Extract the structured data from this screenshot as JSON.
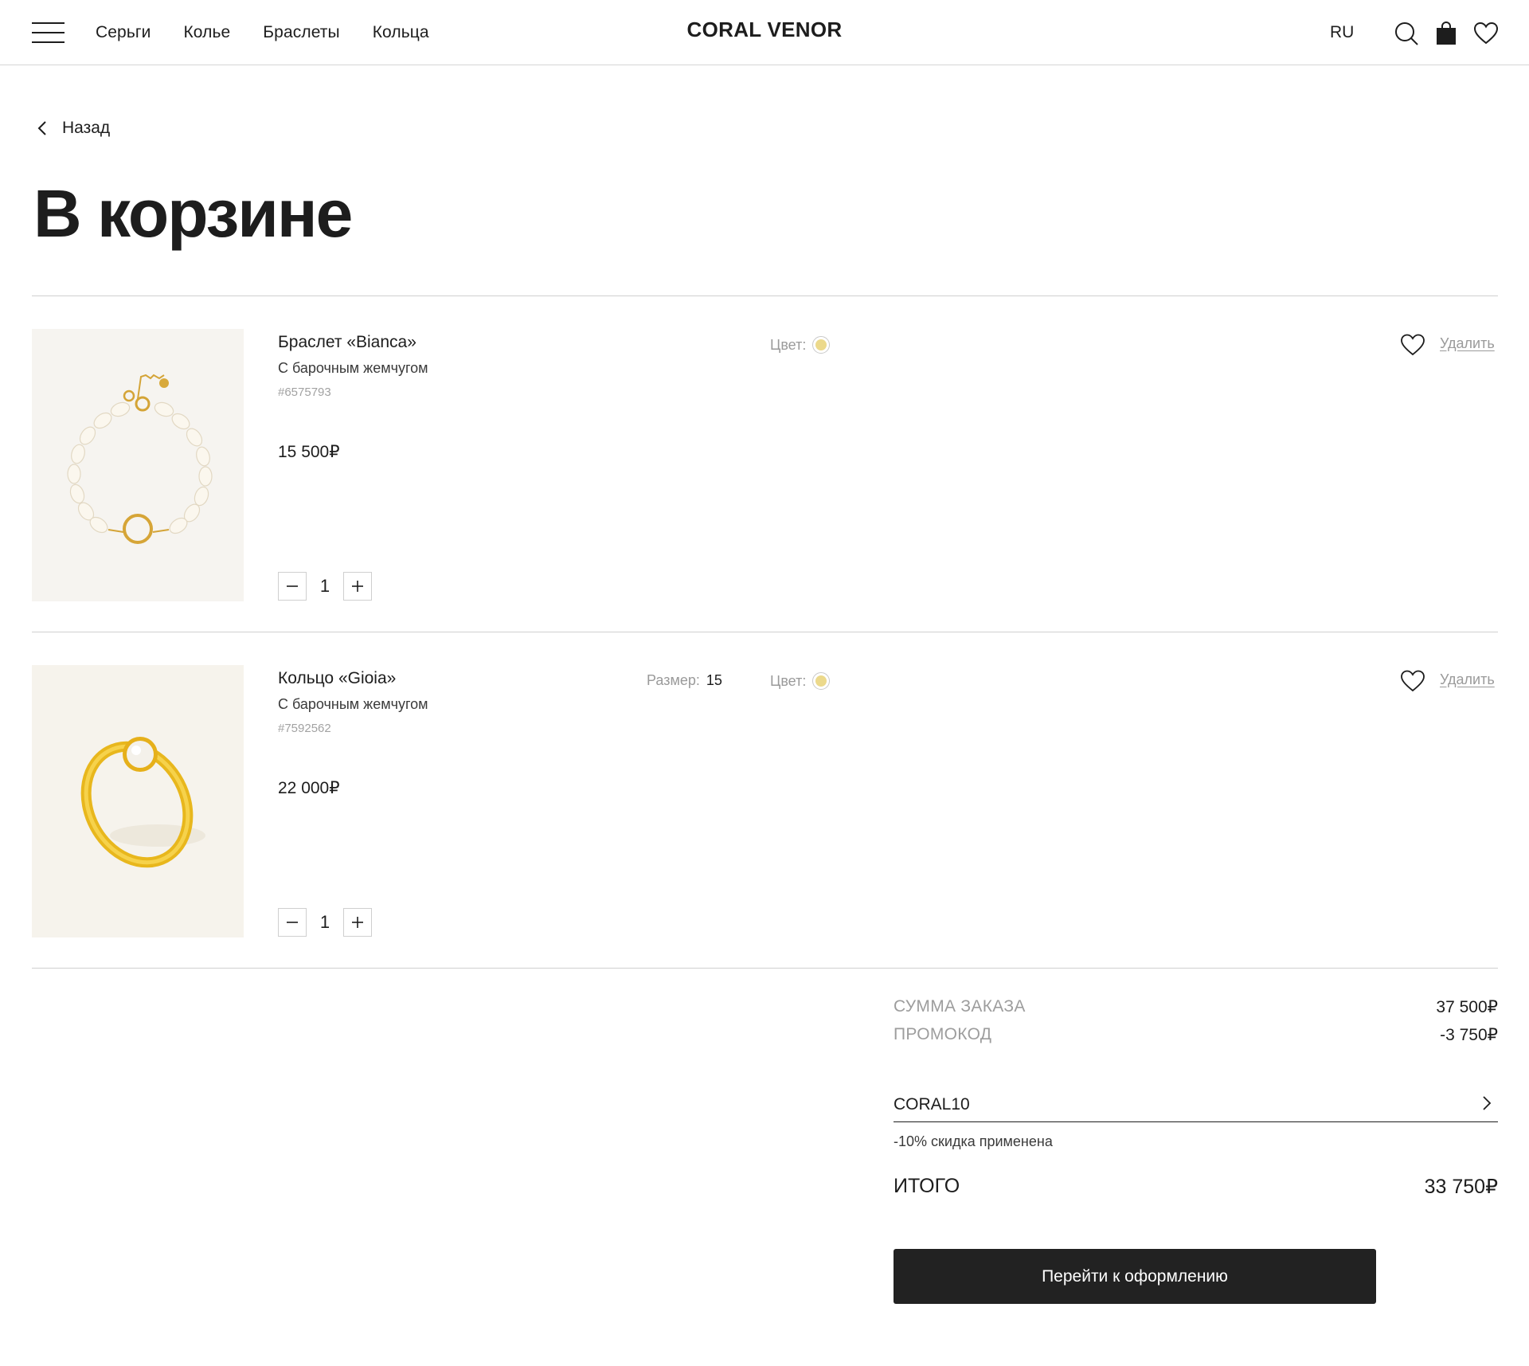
{
  "header": {
    "nav": [
      "Серьги",
      "Колье",
      "Браслеты",
      "Кольца"
    ],
    "brand": "CORAL VENOR",
    "lang": "RU",
    "icons": [
      "menu-icon",
      "search-icon",
      "bag-icon",
      "heart-icon"
    ]
  },
  "back_label": "Назад",
  "page_title": "В корзине",
  "labels": {
    "color": "Цвет:",
    "size": "Размер:",
    "remove": "Удалить"
  },
  "items": [
    {
      "name": "Браслет «Bianca»",
      "subtitle": "С барочным жемчугом",
      "sku": "#6575793",
      "price": "15 500₽",
      "qty": "1",
      "color": "#ecd98b"
    },
    {
      "name": "Кольцо «Gioia»",
      "subtitle": "С барочным жемчугом",
      "sku": "#7592562",
      "size": "15",
      "price": "22 000₽",
      "qty": "1",
      "color": "#ecd98b"
    }
  ],
  "summary": {
    "order_label": "СУММА ЗАКАЗА",
    "order_value": "37 500₽",
    "promo_label": "ПРОМОКОД",
    "promo_value": "-3 750₽",
    "promo_code": "CORAL10",
    "promo_note": "-10% скидка применена",
    "total_label": "ИТОГО",
    "total_value": "33 750₽",
    "checkout_label": "Перейти к оформлению"
  }
}
